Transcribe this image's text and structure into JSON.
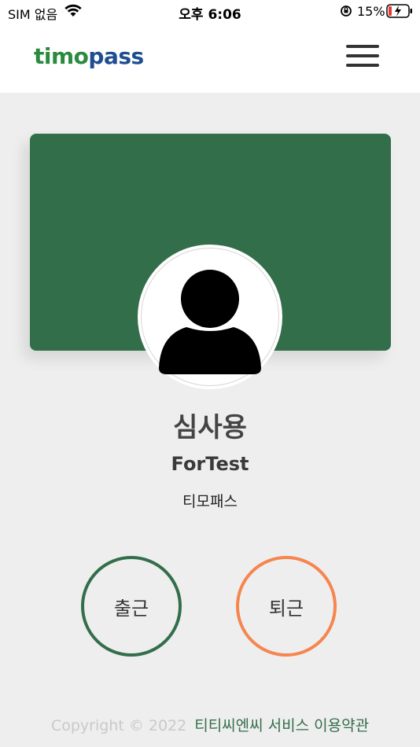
{
  "status_bar": {
    "carrier": "SIM 없음",
    "time": "오후 6:06",
    "battery_percent": "15%"
  },
  "header": {
    "logo_part1": "timo",
    "logo_part2": "pass"
  },
  "profile": {
    "name": "심사용",
    "sub_name": "ForTest",
    "company": "티모패스"
  },
  "actions": {
    "check_in_label": "출근",
    "check_out_label": "퇴근"
  },
  "footer": {
    "copyright": "Copyright © 2022",
    "terms_link": "티티씨엔씨 서비스 이용약관"
  },
  "colors": {
    "brand_green": "#336e4a",
    "accent_orange": "#f5864f",
    "logo_green": "#2b8a3e",
    "logo_blue": "#1e4d91"
  },
  "icons": [
    "wifi-icon",
    "orientation-lock-icon",
    "battery-charging-icon",
    "hamburger-menu-icon",
    "user-avatar-icon"
  ]
}
